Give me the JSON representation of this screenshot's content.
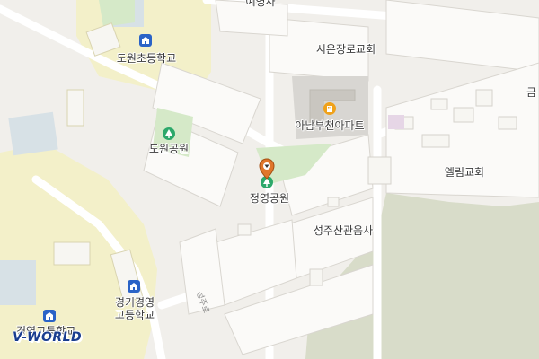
{
  "map": {
    "colors": {
      "background": "#f1efeb",
      "block": "#fbfaf8",
      "block_stroke": "#d9d6d0",
      "school": "#f3f0c9",
      "park": "#d5e9c8",
      "forest": "#d8dcc9",
      "water": "#d7e1e6",
      "apartment": "#d8d6d2",
      "road": "#ffffff",
      "label": "#3a3a3a"
    },
    "labels": {
      "top_temple_partial": "예영사",
      "church_sion": "시온장로교회",
      "school_dowon": "도원초등학교",
      "apartment": "아남부천아파트",
      "park_dowon": "도원공원",
      "park_jeongmyeong": "정영공원",
      "church_ellim": "엘림교회",
      "temple_seongju": "성주산관음사",
      "school_gyeonggi_line1": "경기경영",
      "school_gyeonggi_line2": "고등학교",
      "school_bottom_partial": "경영고등학교",
      "edge_partial": "금",
      "road_name": "성주로"
    },
    "icons": {
      "school_dowon": "school-icon",
      "apartment": "apartment-icon",
      "park_dowon": "park-icon",
      "park_jeongmyeong": "park-icon",
      "school_gyeonggi": "school-icon",
      "school_bottom": "school-icon",
      "marker": "location-pin-icon"
    },
    "logo": "V-WORLD"
  }
}
